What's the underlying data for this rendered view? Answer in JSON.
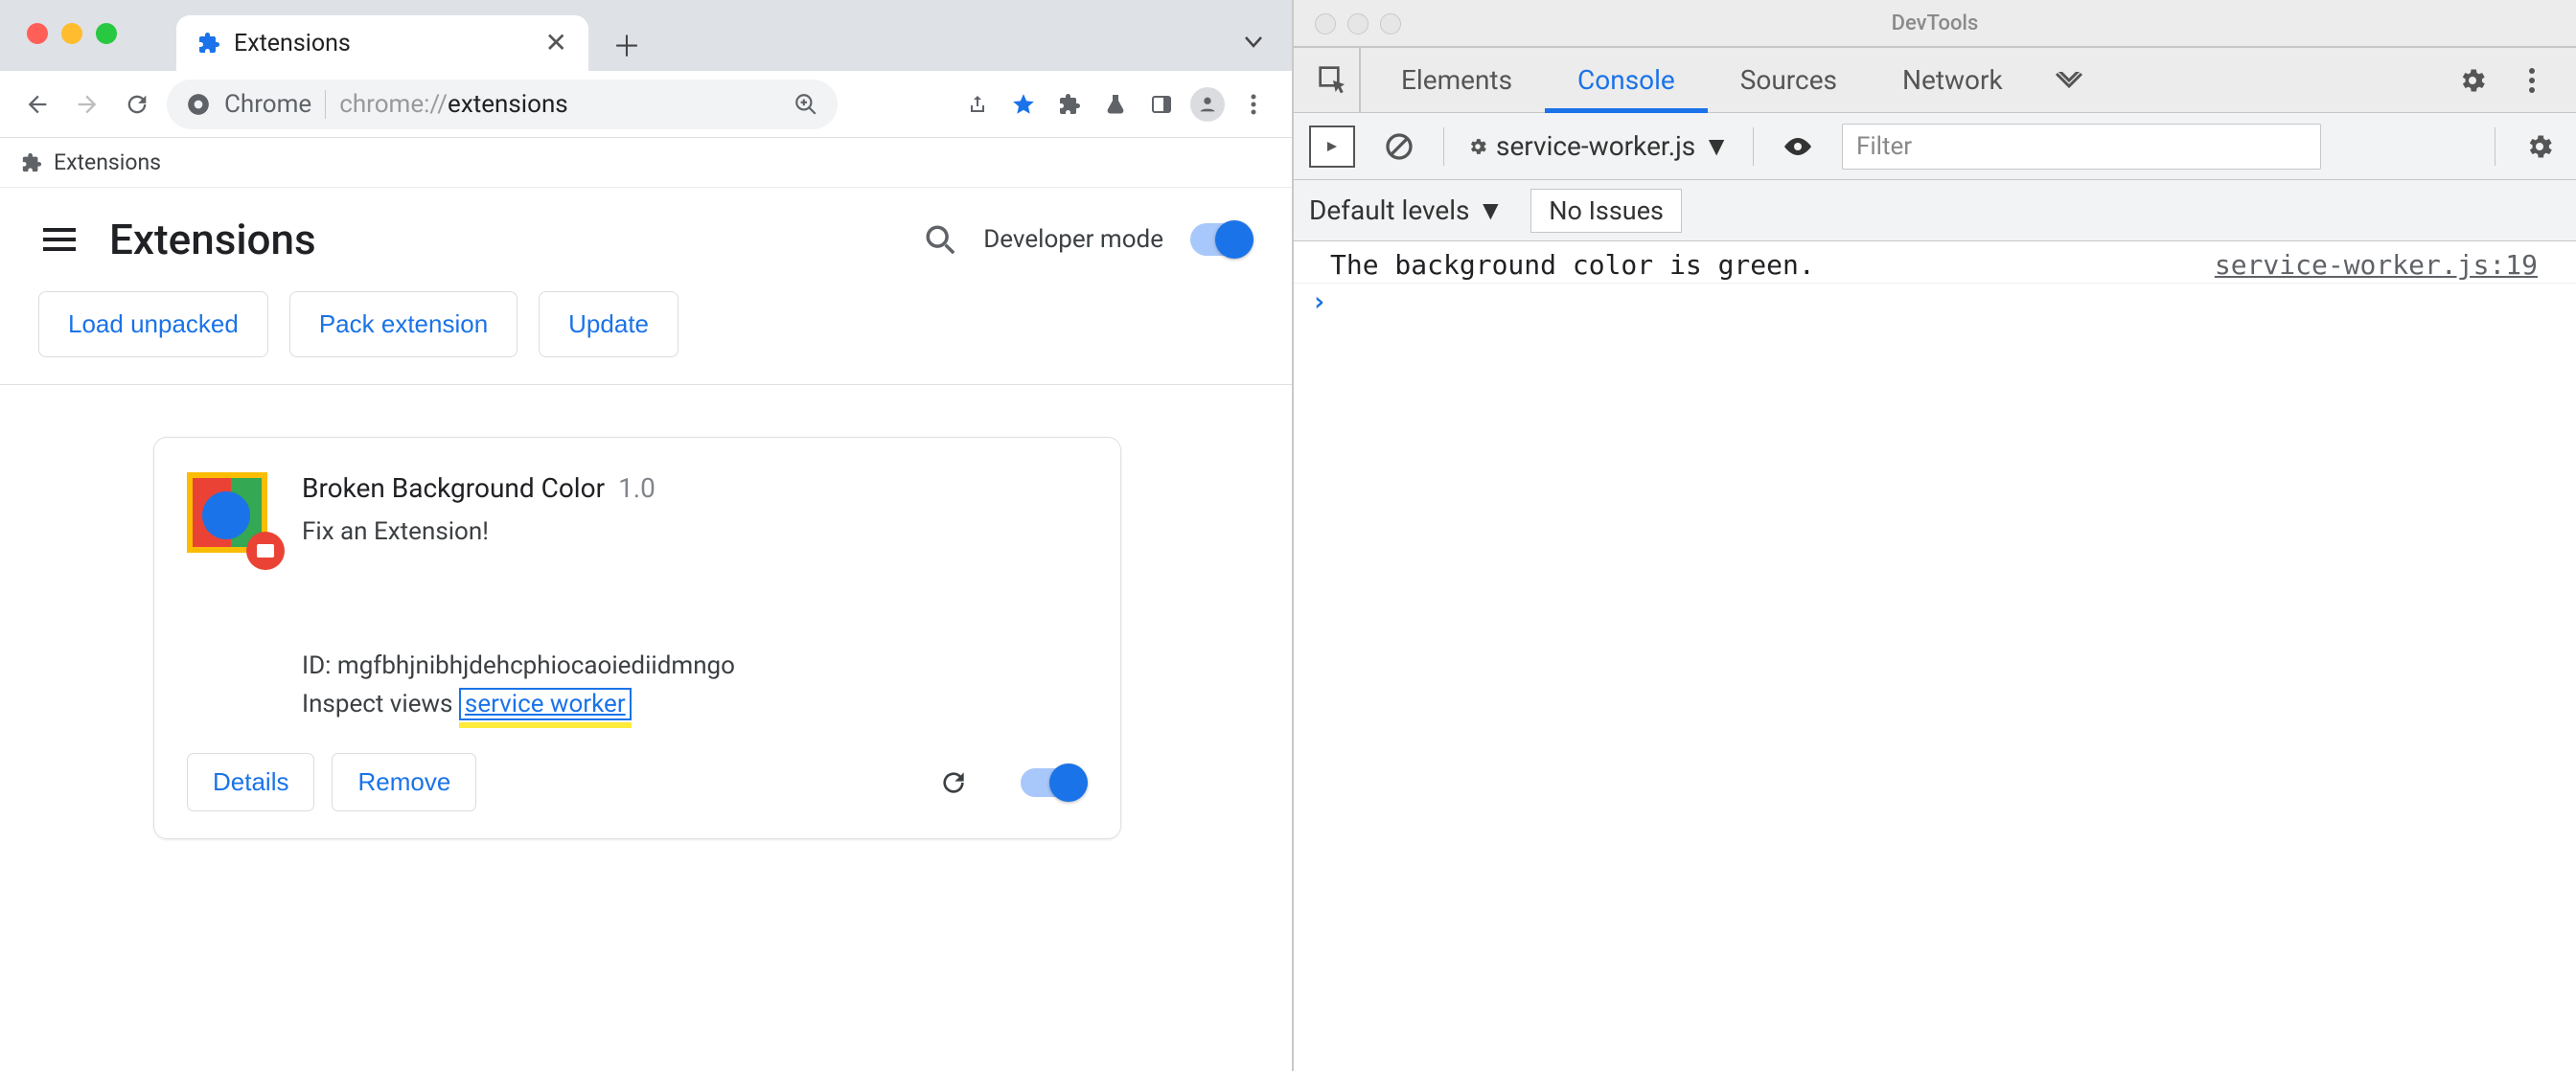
{
  "chrome": {
    "tab": {
      "title": "Extensions"
    },
    "omnibox": {
      "product": "Chrome",
      "url_prefix": "chrome://",
      "url_strong": "extensions"
    },
    "bookmarks_bar": {
      "item1": "Extensions"
    },
    "page": {
      "title": "Extensions",
      "dev_mode_label": "Developer mode",
      "load_unpacked": "Load unpacked",
      "pack_extension": "Pack extension",
      "update": "Update"
    },
    "extension_card": {
      "name": "Broken Background Color",
      "version": "1.0",
      "description": "Fix an Extension!",
      "id_label": "ID: ",
      "id_value": "mgfbhjnibhjdehcphiocaoiediidmngo",
      "inspect_label": "Inspect views ",
      "inspect_link": "service worker",
      "details": "Details",
      "remove": "Remove"
    }
  },
  "devtools": {
    "title": "DevTools",
    "tabs": {
      "elements": "Elements",
      "console": "Console",
      "sources": "Sources",
      "network": "Network"
    },
    "toolbar": {
      "context": "service-worker.js",
      "filter_placeholder": "Filter"
    },
    "toolbar2": {
      "levels": "Default levels",
      "issues": "No Issues"
    },
    "console": {
      "msg": "The background color is green.",
      "src": "service-worker.js:19"
    }
  }
}
